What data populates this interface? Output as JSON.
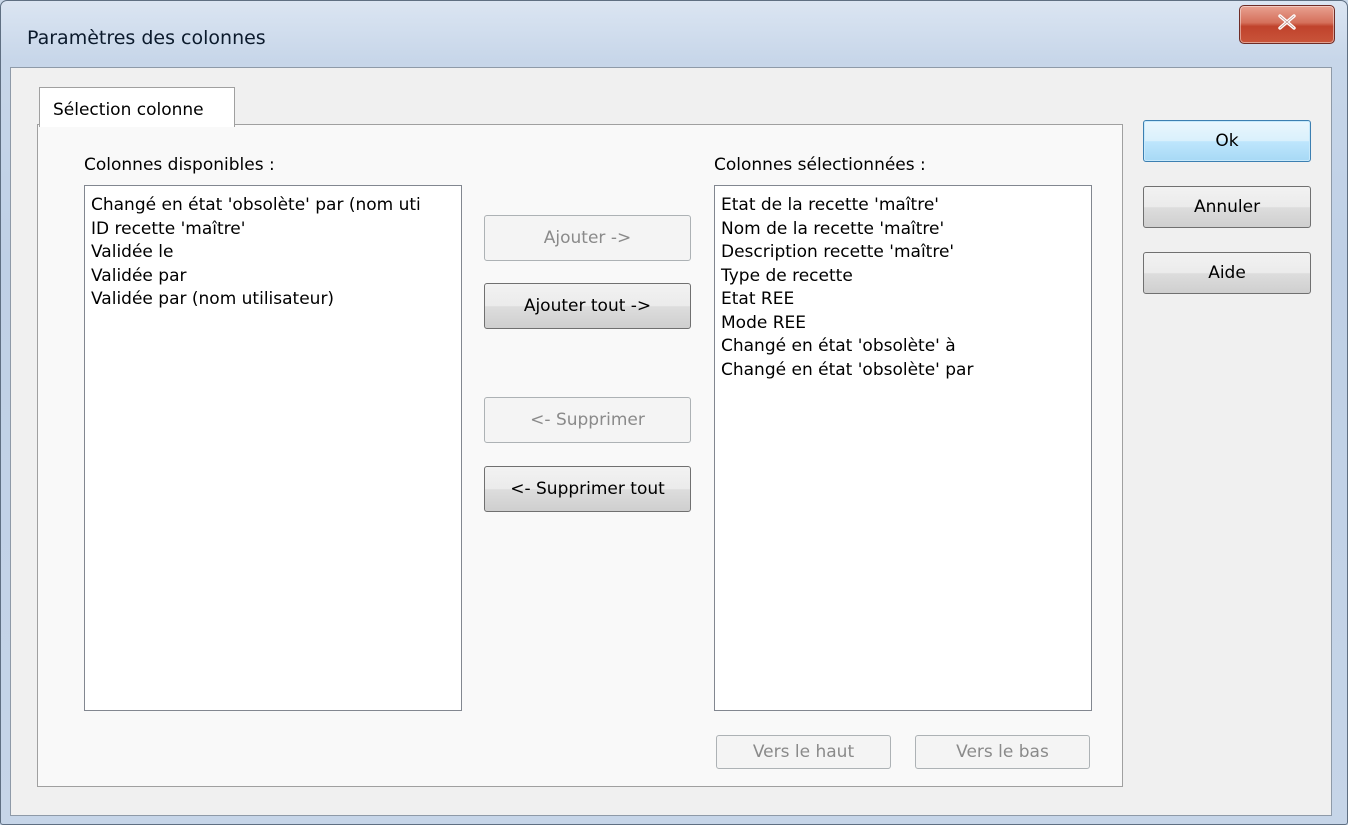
{
  "window": {
    "title": "Paramètres des colonnes",
    "close_label": "X"
  },
  "tabs": [
    {
      "label": "Sélection colonne",
      "active": true
    }
  ],
  "available": {
    "label": "Colonnes disponibles :",
    "items": [
      "Changé en état 'obsolète' par (nom uti",
      "ID recette 'maître'",
      "Validée le",
      "Validée par",
      "Validée par (nom utilisateur)"
    ]
  },
  "selected": {
    "label": "Colonnes sélectionnées :",
    "items": [
      "Etat de la recette 'maître'",
      "Nom de la recette 'maître'",
      "Description recette 'maître'",
      "Type de recette",
      "Etat REE",
      "Mode REE",
      "Changé en état 'obsolète' à",
      "Changé en état 'obsolète' par"
    ]
  },
  "transfer": {
    "add": "Ajouter ->",
    "add_all": "Ajouter tout ->",
    "remove": "<- Supprimer",
    "remove_all": "<- Supprimer tout"
  },
  "order": {
    "up": "Vers le haut",
    "down": "Vers le bas"
  },
  "dialog_buttons": {
    "ok": "Ok",
    "cancel": "Annuler",
    "help": "Aide"
  },
  "colors": {
    "accent": "#3c7fb1",
    "close": "#c7432c",
    "disabled_text": "#8a8a8a"
  }
}
